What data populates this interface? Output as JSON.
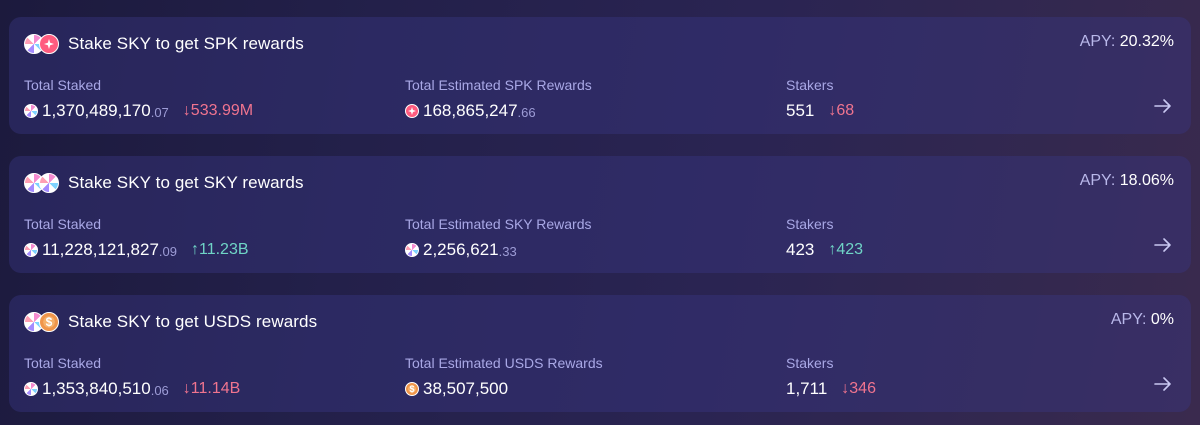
{
  "farms": [
    {
      "title": "Stake SKY to get SPK rewards",
      "apy_label": "APY:",
      "apy_value": "20.32%",
      "total_staked_label": "Total Staked",
      "total_staked_int": "1,370,489,170",
      "total_staked_dec": ".07",
      "total_staked_delta": "↓533.99M",
      "rewards_label": "Total Estimated SPK Rewards",
      "rewards_int": "168,865,247",
      "rewards_dec": ".66",
      "stakers_label": "Stakers",
      "stakers_value": "551",
      "stakers_delta": "↓68",
      "reward_token_icon": "spk-token-icon"
    },
    {
      "title": "Stake SKY to get SKY rewards",
      "apy_label": "APY:",
      "apy_value": "18.06%",
      "total_staked_label": "Total Staked",
      "total_staked_int": "11,228,121,827",
      "total_staked_dec": ".09",
      "total_staked_delta": "↑11.23B",
      "rewards_label": "Total Estimated SKY Rewards",
      "rewards_int": "2,256,621",
      "rewards_dec": ".33",
      "stakers_label": "Stakers",
      "stakers_value": "423",
      "stakers_delta": "↑423",
      "reward_token_icon": "sky-token-icon"
    },
    {
      "title": "Stake SKY to get USDS rewards",
      "apy_label": "APY:",
      "apy_value": "0%",
      "total_staked_label": "Total Staked",
      "total_staked_int": "1,353,840,510",
      "total_staked_dec": ".06",
      "total_staked_delta": "↓11.14B",
      "rewards_label": "Total Estimated USDS Rewards",
      "rewards_int": "38,507,500",
      "rewards_dec": "",
      "stakers_label": "Stakers",
      "stakers_value": "1,711",
      "stakers_delta": "↓346",
      "reward_token_icon": "usds-token-icon"
    }
  ],
  "icons": {
    "arrow": "arrow-right-icon",
    "staking_token": "sky-token-icon"
  },
  "colors": {
    "delta_down": "#f0748f",
    "delta_up": "#6fd4c6",
    "label": "#a9a8e6"
  }
}
